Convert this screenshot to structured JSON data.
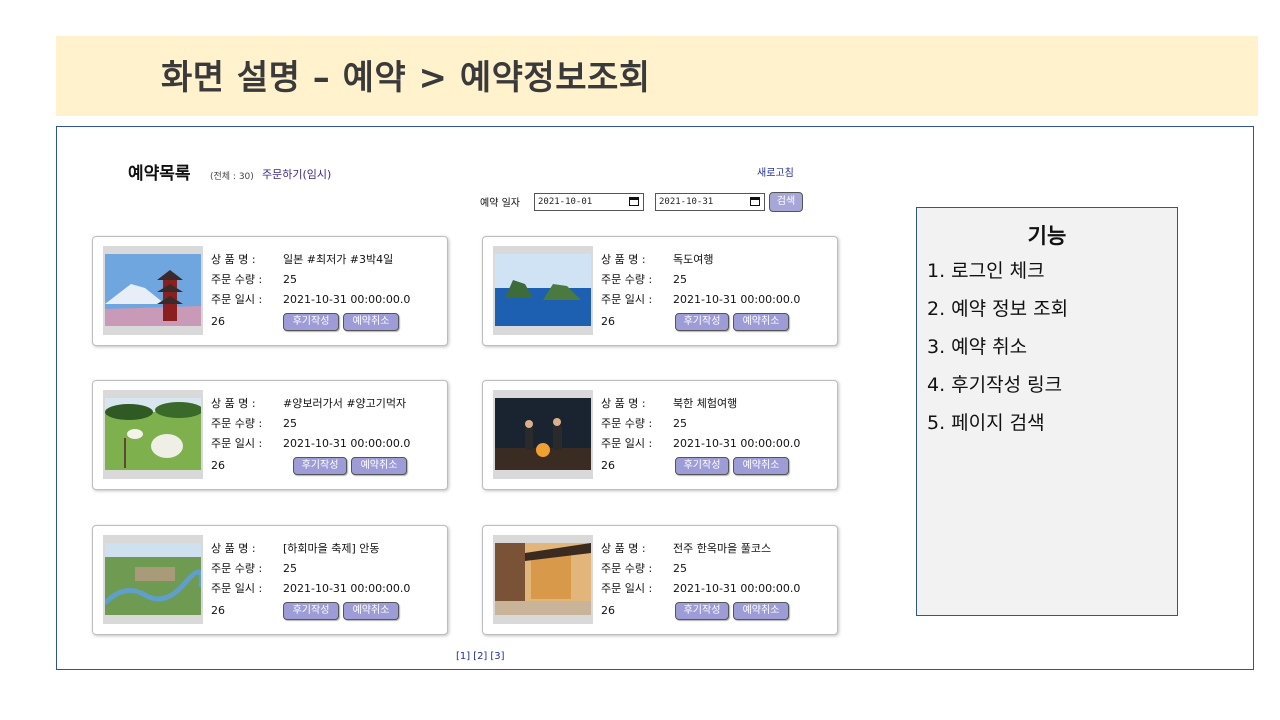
{
  "banner": {
    "title": "화면 설명 – 예약 > 예약정보조회"
  },
  "reservation_list": {
    "title": "예약목록",
    "count_text": "(전체 : 30)",
    "order_link": "주문하기(임시)",
    "refresh_link": "새로고침",
    "date_label": "예약 일자",
    "start_date": "2021-10-01",
    "end_date": "2021-10-31",
    "search_button": "검색",
    "labels": {
      "product": "상 품 명 :",
      "quantity": "주문 수량 :",
      "date": "주문 일시 :"
    },
    "review_button": "후기작성",
    "cancel_button": "예약취소",
    "items": [
      {
        "product": "일본 #최저가 #3박4일",
        "quantity": "25",
        "date": "2021-10-31 00:00:00.0",
        "value": "26",
        "image": "japan-pagoda-photo"
      },
      {
        "product": "독도여행",
        "quantity": "25",
        "date": "2021-10-31 00:00:00.0",
        "value": "26",
        "image": "dokdo-island-photo"
      },
      {
        "product": "#양보러가서 #양고기먹자",
        "quantity": "25",
        "date": "2021-10-31 00:00:00.0",
        "value": "26",
        "image": "sheep-farm-photo"
      },
      {
        "product": "북한 체험여행",
        "quantity": "25",
        "date": "2021-10-31 00:00:00.0",
        "value": "26",
        "image": "night-campfire-photo"
      },
      {
        "product": "[하회마을 축제] 안동",
        "quantity": "25",
        "date": "2021-10-31 00:00:00.0",
        "value": "26",
        "image": "hahoe-village-photo"
      },
      {
        "product": "전주 한옥마을 풀코스",
        "quantity": "25",
        "date": "2021-10-31 00:00:00.0",
        "value": "26",
        "image": "hanok-street-photo"
      }
    ],
    "pagination": [
      "[1]",
      "[2]",
      "[3]"
    ]
  },
  "features": {
    "title": "기능",
    "items": [
      "1. 로그인 체크",
      "2. 예약 정보 조회",
      "3. 예약 취소",
      "4. 후기작성 링크",
      "5. 페이지 검색"
    ]
  }
}
